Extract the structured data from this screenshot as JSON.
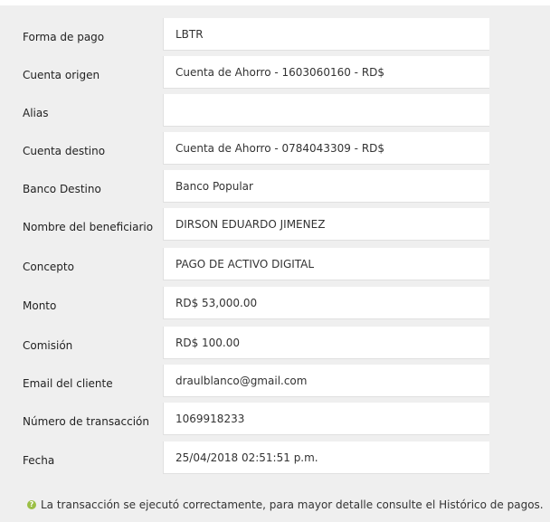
{
  "fields": [
    {
      "label": "Forma de pago",
      "value": "LBTR"
    },
    {
      "label": "Cuenta origen",
      "value": "Cuenta de Ahorro - 1603060160 - RD$"
    },
    {
      "label": "Alias",
      "value": ""
    },
    {
      "label": "Cuenta destino",
      "value": "Cuenta de Ahorro - 0784043309 - RD$"
    },
    {
      "label": "Banco Destino",
      "value": "Banco Popular"
    },
    {
      "label": "Nombre del beneficiario",
      "value": "DIRSON EDUARDO JIMENEZ"
    },
    {
      "label": "Concepto",
      "value": "PAGO DE ACTIVO DIGITAL"
    },
    {
      "label": "Monto",
      "value": "RD$ 53,000.00"
    },
    {
      "label": "Comisión",
      "value": "RD$ 100.00"
    },
    {
      "label": "Email del cliente",
      "value": "draulblanco@gmail.com"
    },
    {
      "label": "Número de transacción",
      "value": "1069918233"
    },
    {
      "label": "Fecha",
      "value": "25/04/2018 02:51:51 p.m."
    }
  ],
  "message": {
    "icon": "question-circle-icon",
    "text": "La transacción se ejecutó correctamente, para mayor detalle consulte el Histórico de pagos."
  },
  "colors": {
    "panel_bg": "#efefef",
    "value_bg": "#ffffff",
    "icon_green": "#9bbf45"
  }
}
